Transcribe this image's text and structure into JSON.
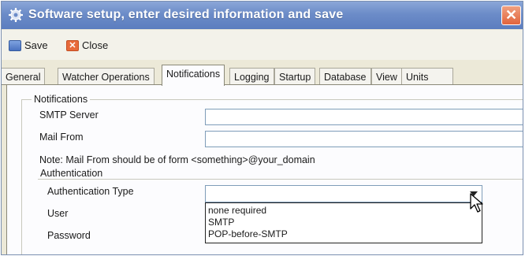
{
  "window": {
    "title": "Software setup, enter desired information and save",
    "close_glyph": "✕"
  },
  "toolbar": {
    "save_label": "Save",
    "close_label": "Close",
    "close_glyph": "✕"
  },
  "tabs": [
    {
      "label": "General"
    },
    {
      "label": "Watcher Operations"
    },
    {
      "label": "Notifications",
      "active": true
    },
    {
      "label": "Logging"
    },
    {
      "label": "Startup"
    },
    {
      "label": "Database"
    },
    {
      "label": "View"
    },
    {
      "label": "Units"
    }
  ],
  "notifications": {
    "group_label": "Notifications",
    "smtp_server_label": "SMTP Server",
    "smtp_server_value": "",
    "mail_from_label": "Mail From",
    "mail_from_value": "",
    "note": "Note: Mail From should be of form <something>@your_domain",
    "authentication": {
      "group_label": "Authentication",
      "type_label": "Authentication Type",
      "type_value": "",
      "user_label": "User",
      "password_label": "Password",
      "options": [
        "none required",
        "SMTP",
        "POP-before-SMTP"
      ]
    }
  },
  "colors": {
    "titlebar": "#6c8cc8",
    "accent_close": "#e2643c",
    "field_border": "#7f9db9"
  }
}
